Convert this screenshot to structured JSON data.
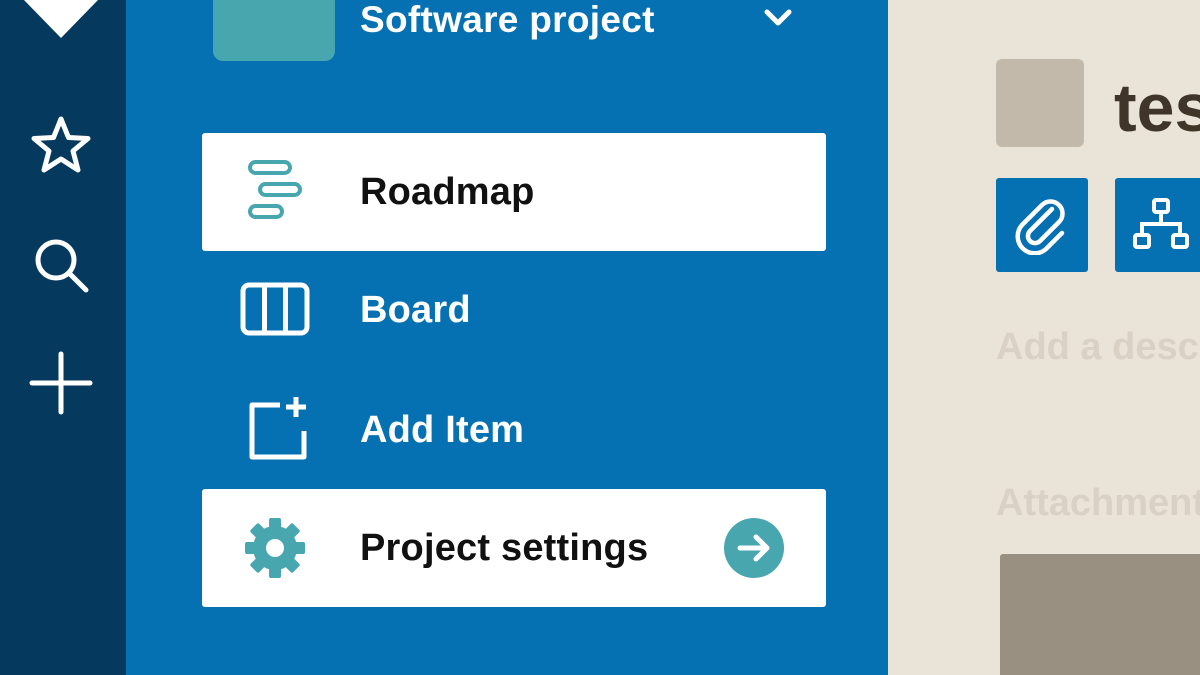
{
  "global_nav": {
    "logo_icon": "chevron-down-logo",
    "items": [
      {
        "icon": "star-icon"
      },
      {
        "icon": "search-icon"
      },
      {
        "icon": "plus-icon"
      }
    ]
  },
  "project": {
    "name": "Software project",
    "menu_icon": "chevron-down-icon"
  },
  "nav": {
    "items": [
      {
        "label": "Roadmap",
        "icon": "roadmap-icon",
        "active": true
      },
      {
        "label": "Board",
        "icon": "board-icon",
        "active": false
      },
      {
        "label": "Add Item",
        "icon": "add-item-icon",
        "active": false
      },
      {
        "label": "Project settings",
        "icon": "gear-icon",
        "active": true,
        "action_icon": "arrow-right-icon"
      }
    ]
  },
  "detail": {
    "title": "tes",
    "actions": [
      {
        "icon": "paperclip-icon"
      },
      {
        "icon": "hierarchy-icon"
      }
    ],
    "description_placeholder": "Add a descr",
    "attachments_heading": "Attachment"
  },
  "colors": {
    "global_nav_bg": "#05395d",
    "project_nav_bg": "#0570b2",
    "accent_teal": "#48a6ae",
    "panel_bg": "#e9e3d8"
  }
}
